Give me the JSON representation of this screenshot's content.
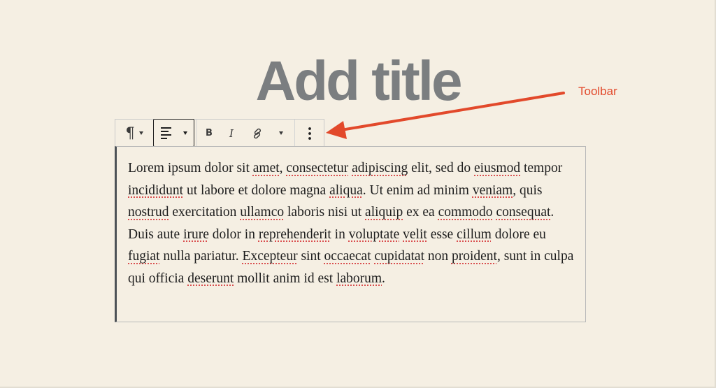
{
  "editor": {
    "title_placeholder": "Add title"
  },
  "annotation": {
    "label": "Toolbar",
    "color": "#e2492b"
  },
  "toolbar": {
    "paragraph_icon": "¶",
    "bold_label": "B",
    "italic_label": "I",
    "icons": [
      "pilcrow-icon",
      "align-left-icon",
      "bold-icon",
      "italic-icon",
      "link-icon",
      "chevron-down-icon",
      "more-vertical-icon"
    ]
  },
  "paragraph": {
    "segments": [
      {
        "t": "Lorem ipsum dolor sit "
      },
      {
        "t": "amet",
        "sp": true
      },
      {
        "t": ", "
      },
      {
        "t": "consectetur",
        "sp": true
      },
      {
        "t": " "
      },
      {
        "t": "adipiscing",
        "sp": true
      },
      {
        "t": " elit, sed do "
      },
      {
        "t": "eiusmod",
        "sp": true
      },
      {
        "t": " tempor "
      },
      {
        "t": "incididunt",
        "sp": true
      },
      {
        "t": " ut labore et dolore magna "
      },
      {
        "t": "aliqua",
        "sp": true
      },
      {
        "t": ". Ut enim ad minim "
      },
      {
        "t": "veniam",
        "sp": true
      },
      {
        "t": ", quis "
      },
      {
        "t": "nostrud",
        "sp": true
      },
      {
        "t": " exercitation "
      },
      {
        "t": "ullamco",
        "sp": true
      },
      {
        "t": " laboris nisi ut "
      },
      {
        "t": "aliquip",
        "sp": true
      },
      {
        "t": " ex ea "
      },
      {
        "t": "commodo",
        "sp": true
      },
      {
        "t": " "
      },
      {
        "t": "consequat",
        "sp": true
      },
      {
        "t": ". Duis aute "
      },
      {
        "t": "irure",
        "sp": true
      },
      {
        "t": " dolor in "
      },
      {
        "t": "reprehenderit",
        "sp": true
      },
      {
        "t": " in "
      },
      {
        "t": "voluptate",
        "sp": true
      },
      {
        "t": " "
      },
      {
        "t": "velit",
        "sp": true
      },
      {
        "t": " esse "
      },
      {
        "t": "cillum",
        "sp": true
      },
      {
        "t": " dolore eu "
      },
      {
        "t": "fugiat",
        "sp": true
      },
      {
        "t": " nulla pariatur. "
      },
      {
        "t": "Excepteur",
        "sp": true
      },
      {
        "t": " sint "
      },
      {
        "t": "occaecat",
        "sp": true
      },
      {
        "t": " "
      },
      {
        "t": "cupidatat",
        "sp": true
      },
      {
        "t": " non "
      },
      {
        "t": "proident",
        "sp": true
      },
      {
        "t": ", sunt in culpa qui officia "
      },
      {
        "t": "deserunt",
        "sp": true
      },
      {
        "t": " mollit anim id est "
      },
      {
        "t": "laborum",
        "sp": true
      },
      {
        "t": "."
      }
    ]
  }
}
